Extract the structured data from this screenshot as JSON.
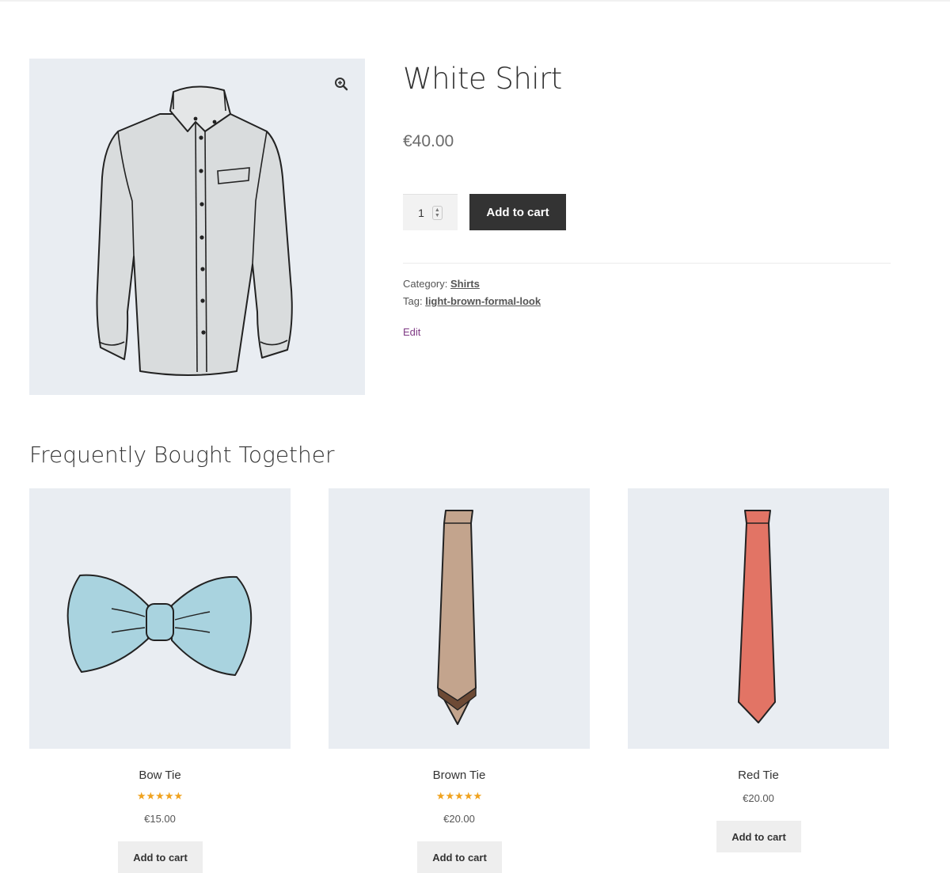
{
  "product": {
    "title": "White Shirt",
    "price": "€40.00",
    "quantity": "1",
    "add_to_cart_label": "Add to cart",
    "category_label": "Category:",
    "category_value": "Shirts",
    "tag_label": "Tag:",
    "tag_value": "light-brown-formal-look",
    "edit_label": "Edit",
    "icons": {
      "zoom": "zoom-in-icon",
      "spinner": "quantity-spinner-icon"
    }
  },
  "related": {
    "title": "Frequently Bought Together",
    "items": [
      {
        "name": "Bow Tie",
        "price": "€15.00",
        "rating": 5,
        "stars": "★★★★★",
        "button": "Add to cart"
      },
      {
        "name": "Brown Tie",
        "price": "€20.00",
        "rating": 5,
        "stars": "★★★★★",
        "button": "Add to cart"
      },
      {
        "name": "Red Tie",
        "price": "€20.00",
        "button": "Add to cart"
      }
    ]
  },
  "colors": {
    "image_bg": "#e9edf2",
    "primary_button": "#333333",
    "secondary_button": "#eeeeee",
    "star": "#f0a21e",
    "edit_link": "#7f3a85"
  }
}
